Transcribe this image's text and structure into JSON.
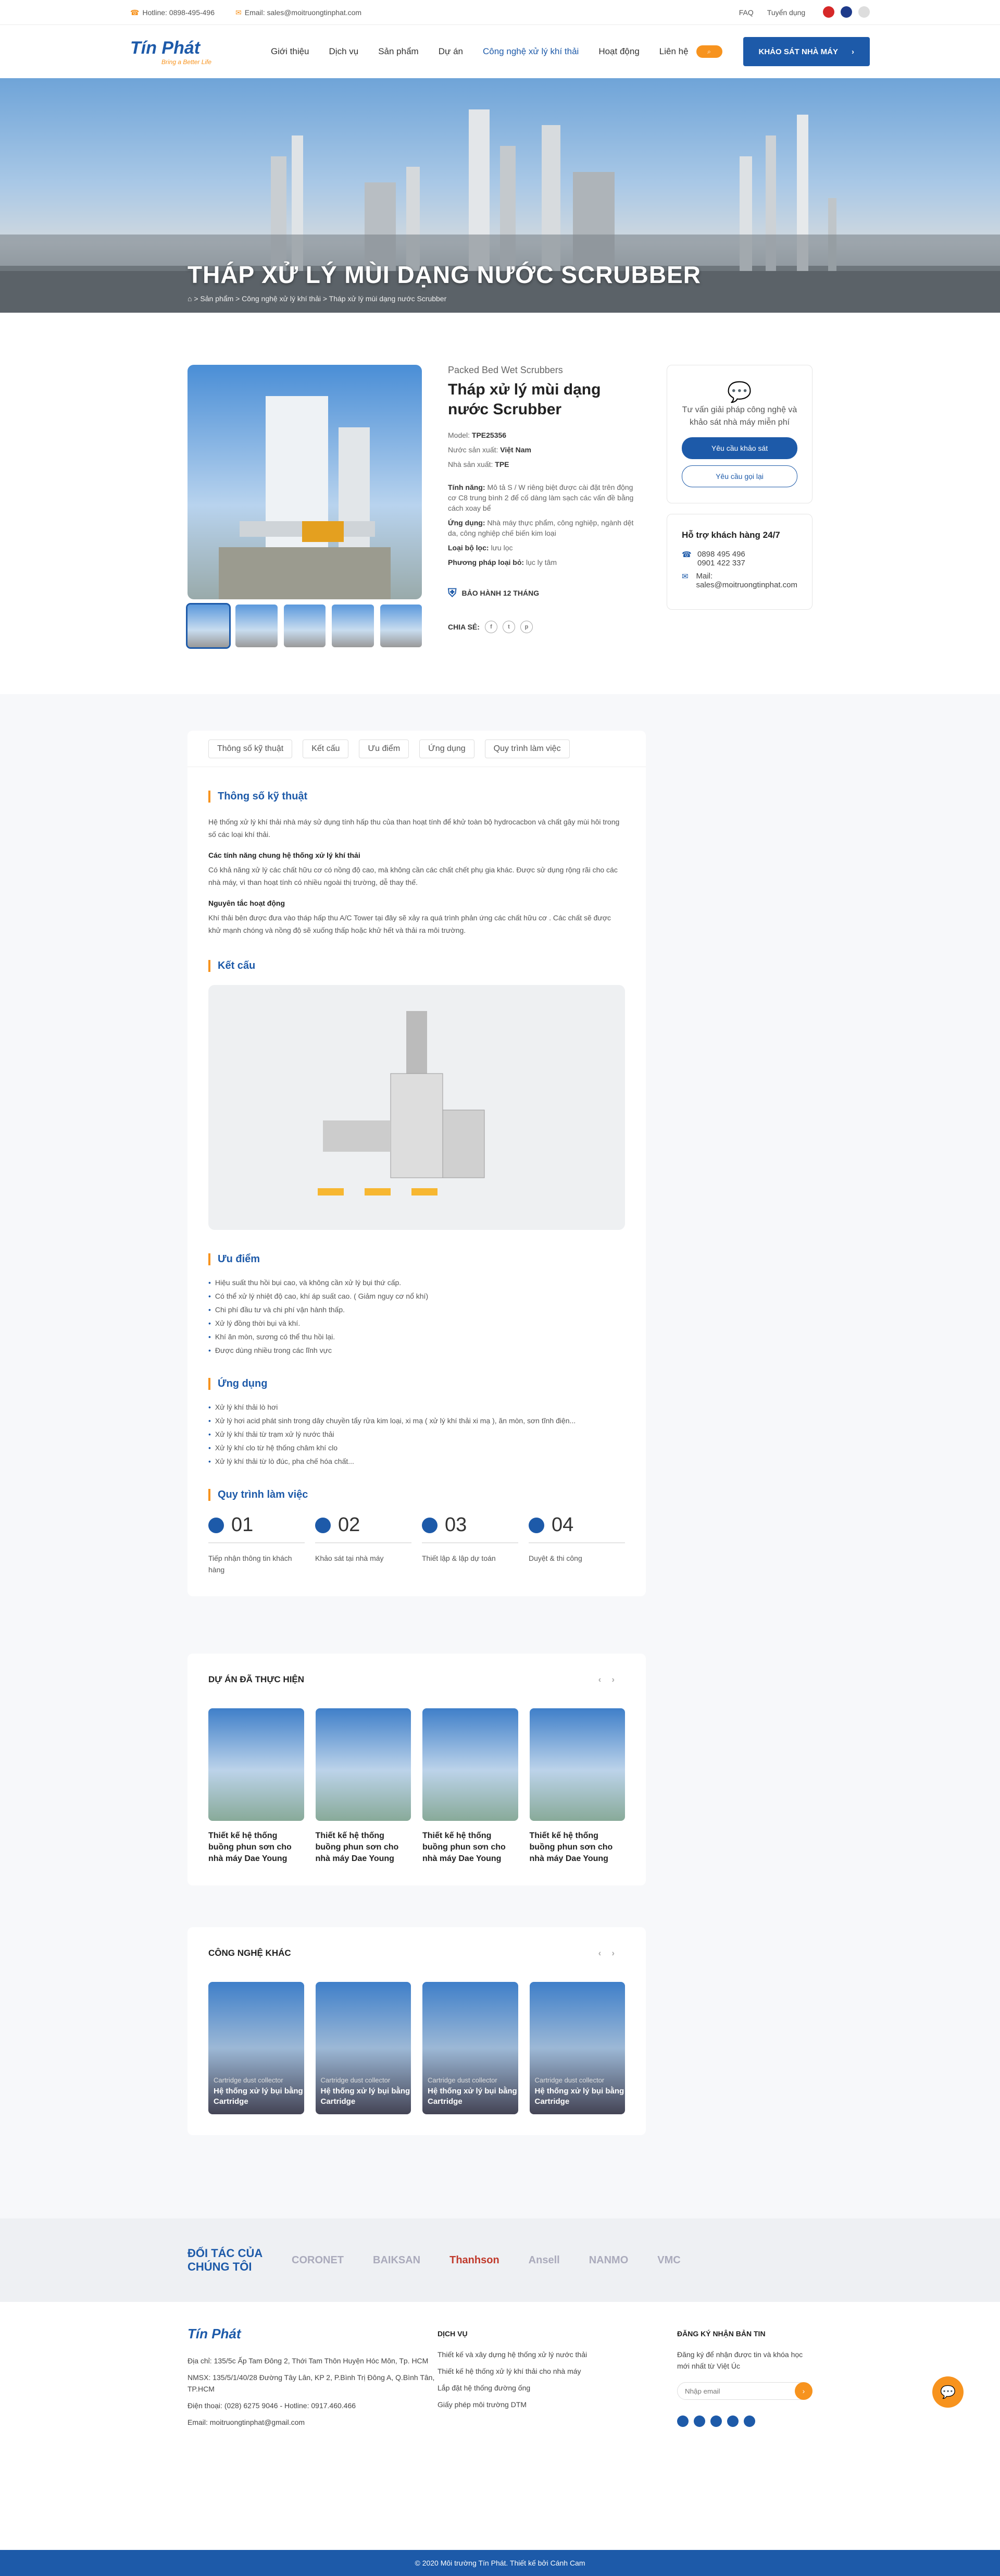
{
  "topbar": {
    "hotline": "Hotline: 0898-495-496",
    "email": "Email: sales@moitruongtinphat.com",
    "faq": "FAQ",
    "recruit": "Tuyển dụng"
  },
  "header": {
    "brand": "Tín Phát",
    "tagline": "Bring a Better Life",
    "nav": [
      "Giới thiệu",
      "Dịch vụ",
      "Sản phẩm",
      "Dự án",
      "Công nghệ xử lý khí thải",
      "Hoạt động",
      "Liên hệ"
    ],
    "cta": "KHẢO SÁT NHÀ MÁY"
  },
  "hero": {
    "title": "THÁP XỬ LÝ MÙI DẠNG NƯỚC SCRUBBER",
    "crumb": "⌂ > Sản phẩm > Công nghệ xử lý khí thải > Tháp xử lý mùi dạng nước Scrubber"
  },
  "product": {
    "subtitle": "Packed Bed Wet Scrubbers",
    "name": "Tháp xử lý mùi dạng nước Scrubber",
    "model_label": "Model:",
    "model": "TPE25356",
    "origin_label": "Nước sản xuất:",
    "origin": "Việt Nam",
    "maker_label": "Nhà sản xuất:",
    "maker": "TPE",
    "feature_label": "Tính năng:",
    "feature": "Mô tả S / W riêng biệt được cài đặt trên động cơ C8 trung bình 2 để cố dàng làm sạch các vấn đề bằng cách xoay bể",
    "app_label": "Ứng dụng:",
    "app": "Nhà máy thực phẩm, công nghiệp, ngành dệt da, công nghiệp chế biến kim loại",
    "filter_label": "Loại bộ lọc:",
    "filter": "lưu lọc",
    "method_label": "Phương pháp loại bỏ:",
    "method": "lục ly tâm",
    "warranty": "BẢO HÀNH 12 THÁNG",
    "share": "CHIA SẺ:"
  },
  "side": {
    "msg": "Tư vấn giải pháp công nghệ và khảo sát nhà máy miễn phí",
    "btn1": "Yêu cầu khảo sát",
    "btn2": "Yêu cầu gọi lại",
    "support": "Hỗ trợ khách hàng 24/7",
    "phone1": "0898 495 496",
    "phone2": "0901 422 337",
    "mail_label": "Mail:",
    "mail": "sales@moitruongtinphat.com"
  },
  "tabs": [
    "Thông số kỹ thuật",
    "Kết cấu",
    "Ưu điểm",
    "Ứng dụng",
    "Quy trình làm việc"
  ],
  "specs": {
    "title": "Thông số kỹ thuật",
    "p1": "Hệ thống xử lý khí thải nhà máy sử dụng tính hấp thu của than hoạt tính để khử toàn bộ hydrocacbon và chất gây mùi hôi trong số các loại khí thải.",
    "h1": "Các tính năng chung hệ thống xử lý khí thải",
    "p2": "Có khả năng xử lý các chất hữu cơ có nồng độ cao, mà không cần các chất chết phụ gia khác. Được sử dụng rộng rãi cho các nhà máy, vì than hoạt tính có nhiều ngoài thị trường, dễ thay thế.",
    "h2": "Nguyên tắc hoạt động",
    "p3": "Khí thải bên được đưa vào tháp hấp thu A/C Tower tại đây sẽ xảy ra quá trình phản ứng các chất hữu cơ . Các chất sẽ được khử mạnh chóng và nồng độ sẽ xuống thấp hoặc khử hết và thải ra môi trường."
  },
  "structure": {
    "title": "Kết cấu"
  },
  "advantages": {
    "title": "Ưu điểm",
    "items": [
      "Hiệu suất thu hồi bụi cao, và không cần xử lý bụi thứ cấp.",
      "Có thể xử lý nhiệt độ cao, khí áp suất cao. ( Giảm nguy cơ nổ khí)",
      "Chi phí đầu tư và chi phí vận hành thấp.",
      "Xử lý đồng thời bụi và khí.",
      "Khí ăn mòn, sương có thể thu hồi lại.",
      "Được dùng nhiều trong các lĩnh vực"
    ]
  },
  "applications": {
    "title": "Ứng dụng",
    "items": [
      "Xử lý khí thải lò hơi",
      "Xử lý hơi acid phát sinh trong dây chuyền tẩy rửa kim loại, xi mạ ( xử lý khí thải xi mạ ), ăn mòn, sơn tĩnh điện...",
      "Xử lý khí thải từ trạm xử lý nước thải",
      "Xử lý khí clo từ hệ thống châm khí clo",
      "Xử lý khí thải từ lò đúc, pha chế hóa chất..."
    ]
  },
  "process": {
    "title": "Quy trình làm việc",
    "steps": [
      {
        "n": "01",
        "label": "Tiếp nhận thông tin khách hàng"
      },
      {
        "n": "02",
        "label": "Khảo sát tại nhà máy"
      },
      {
        "n": "03",
        "label": "Thiết lập & lập dự toán"
      },
      {
        "n": "04",
        "label": "Duyệt & thi công"
      }
    ]
  },
  "projects": {
    "title": "DỰ ÁN ĐÃ THỰC HIỆN",
    "items": [
      "Thiết kế hệ thống buồng phun sơn cho nhà máy Dae Young",
      "Thiết kế hệ thống buồng phun sơn cho nhà máy Dae Young",
      "Thiết kế hệ thống buồng phun sơn cho nhà máy Dae Young",
      "Thiết kế hệ thống buồng phun sơn cho nhà máy Dae Young"
    ]
  },
  "tech": {
    "title": "CÔNG NGHỆ KHÁC",
    "items": [
      {
        "s": "Cartridge dust collector",
        "b": "Hệ thống xử lý bụi bằng Cartridge"
      },
      {
        "s": "Cartridge dust collector",
        "b": "Hệ thống xử lý bụi bằng Cartridge"
      },
      {
        "s": "Cartridge dust collector",
        "b": "Hệ thống xử lý bụi bằng Cartridge"
      },
      {
        "s": "Cartridge dust collector",
        "b": "Hệ thống xử lý bụi bằng Cartridge"
      }
    ]
  },
  "partners": {
    "title": "ĐỐI TÁC CỦA CHÚNG TÔI",
    "logos": [
      "CORONET",
      "BAIKSAN",
      "Thanhson",
      "Ansell",
      "NANMO",
      "VMC"
    ]
  },
  "footer": {
    "addr": "Địa chỉ: 135/5c Ấp Tam Đông 2, Thới Tam Thôn Huyện Hóc Môn, Tp. HCM",
    "nmsx": "NMSX: 135/5/1/40/28 Đường Tây Lân, KP 2, P.Bình Trị Đông A, Q.Bình Tân, TP.HCM",
    "phone": "Điện thoại: (028) 6275 9046 - Hotline: 0917.460.466",
    "email": "Email: moitruongtinphat@gmail.com",
    "svc_title": "DỊCH VỤ",
    "svc": [
      "Thiết kế và xây dựng hệ thống xử lý nước thải",
      "Thiết kế hệ thống xử lý khí thải cho nhà máy",
      "Lắp đặt hệ thống đường ống",
      "Giấy phép môi trường DTM"
    ],
    "news_title": "ĐĂNG KÝ NHẬN BẢN TIN",
    "news_desc": "Đăng ký để nhận được tin và khóa học mới nhất từ Việt Úc",
    "news_placeholder": "Nhập email",
    "copyright": "© 2020 Môi trường Tín Phát. Thiết kế bởi Cánh Cam"
  }
}
